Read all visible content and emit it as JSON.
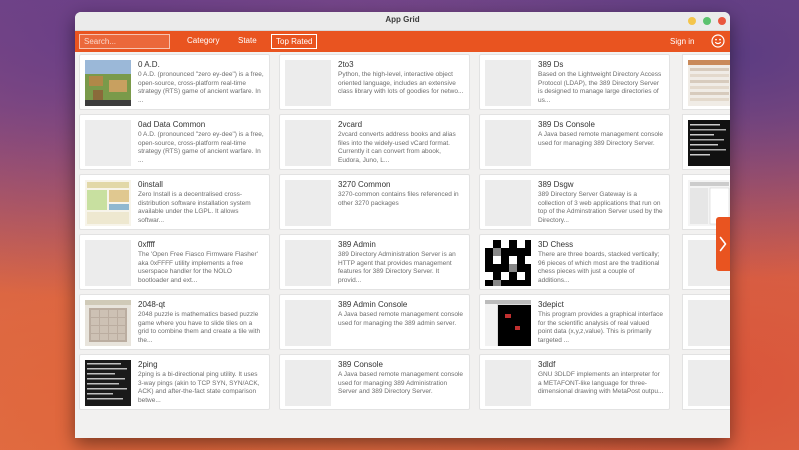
{
  "window": {
    "title": "App Grid"
  },
  "toolbar": {
    "search_placeholder": "Search...",
    "category_label": "Category",
    "state_label": "State",
    "top_rated_label": "Top Rated",
    "signin_label": "Sign in",
    "profile_icon": "smiley-icon",
    "accent_color": "#e95420"
  },
  "apps": [
    {
      "name": "0 A.D.",
      "desc": "0 A.D. (pronounced \"zero ey-dee\") is a free, open-source, cross-platform real-time strategy (RTS) game of ancient warfare. In ..."
    },
    {
      "name": "2to3",
      "desc": "Python, the high-level, interactive object oriented language, includes an extensive class library with lots of goodies for netwo..."
    },
    {
      "name": "389 Ds",
      "desc": "Based on the Lightweight Directory Access Protocol (LDAP), the 389 Directory Server is designed to manage large directories of us..."
    },
    {
      "name": "0ad Data Common",
      "desc": "0 A.D. (pronounced \"zero ey-dee\") is a free, open-source, cross-platform real-time strategy (RTS) game of ancient warfare. In ..."
    },
    {
      "name": "2vcard",
      "desc": "2vcard converts address books and alias files into the widely-used vCard format. Currently it can convert from abook, Eudora, Juno, L..."
    },
    {
      "name": "389 Ds Console",
      "desc": "A Java based remote management console used for managing 389 Directory Server."
    },
    {
      "name": "0install",
      "desc": "Zero Install is a decentralised cross-distribution software installation system available under the LGPL. It allows softwar..."
    },
    {
      "name": "3270 Common",
      "desc": "3270-common contains files referenced in other 3270 packages"
    },
    {
      "name": "389 Dsgw",
      "desc": "389 Directory Server Gateway is a collection of 3 web applications that run on top of the Adminstration Server used by the Directory..."
    },
    {
      "name": "0xffff",
      "desc": "The 'Open Free Fiasco Firmware Flasher' aka 0xFFFF utility implements a free userspace handler for the NOLO bootloader and ext..."
    },
    {
      "name": "389 Admin",
      "desc": "389 Directory Administration Server is an HTTP agent that provides management features for 389 Directory Server. It provid..."
    },
    {
      "name": "3D Chess",
      "desc": "There are three boards, stacked vertically; 96 pieces of which most are the traditional chess pieces with just a couple of additions..."
    },
    {
      "name": "2048-qt",
      "desc": "2048 puzzle is mathematics based puzzle game where you have to slide tiles on a grid to combine them and create a tile with the..."
    },
    {
      "name": "389 Admin Console",
      "desc": "A Java based remote management console used for managing the 389 admin server."
    },
    {
      "name": "3depict",
      "desc": "This program provides a graphical interface for the scientific analysis of real valued point data (x,y,z,value). This is primarily targeted ..."
    },
    {
      "name": "2ping",
      "desc": "2ping is a bi-directional ping utility. It uses 3-way pings (akin to TCP SYN, SYN/ACK, ACK) and after-the-fact state comparison betwe..."
    },
    {
      "name": "389 Console",
      "desc": "A Java based remote management console used for managing 389 Administration Server and 389 Directory Server."
    },
    {
      "name": "3dldf",
      "desc": "GNU 3DLDF implements an interpreter for a METAFONT-like language for three-dimensional drawing with MetaPost outpu..."
    }
  ],
  "next_page_icon": "chevron-right-icon"
}
